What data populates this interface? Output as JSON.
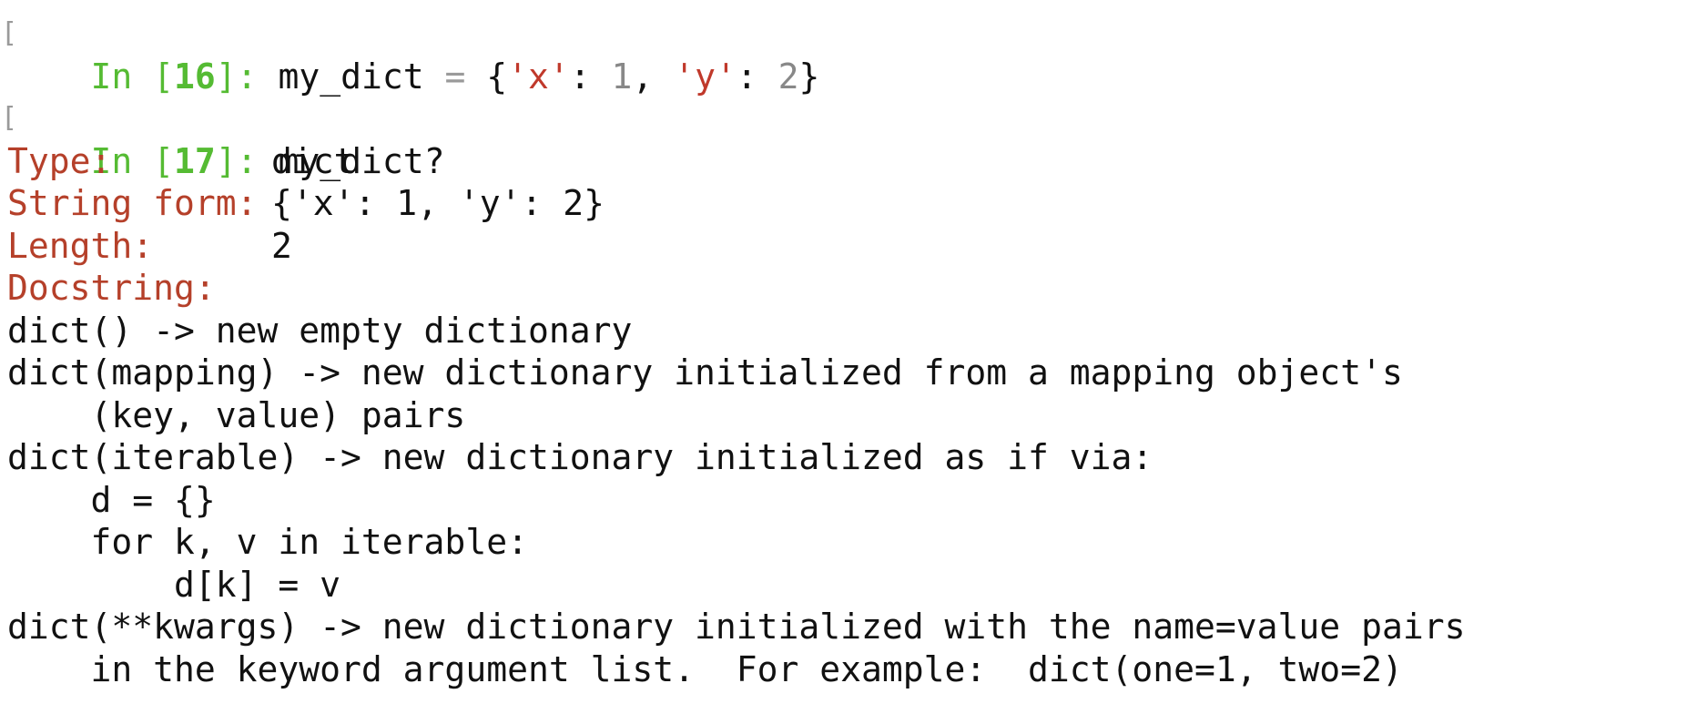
{
  "colors": {
    "prompt_green": "#55bb33",
    "string_red": "#c0392b",
    "number_gray": "#888888",
    "header_red": "#b5402a",
    "text": "#111111",
    "background": "#ffffff"
  },
  "cell16": {
    "prompt_in": "In ",
    "prompt_lbr": "[",
    "prompt_num": "16",
    "prompt_rbr": "]: ",
    "code_a": "my_dict ",
    "code_eq": "=",
    "code_b": " {",
    "str_x": "'x'",
    "colon1": ": ",
    "num1": "1",
    "comma": ", ",
    "str_y": "'y'",
    "colon2": ": ",
    "num2": "2",
    "close": "}"
  },
  "cell17": {
    "prompt_in": "In ",
    "prompt_lbr": "[",
    "prompt_num": "17",
    "prompt_rbr": "]: ",
    "code": "my_dict?"
  },
  "info": {
    "type_label": "Type:",
    "type_value": "dict",
    "string_form_label": "String form:",
    "string_form_value": "{'x': 1, 'y': 2}",
    "length_label": "Length:",
    "length_value": "2",
    "docstring_label": "Docstring:"
  },
  "docstring_lines": [
    "dict() -> new empty dictionary",
    "dict(mapping) -> new dictionary initialized from a mapping object's",
    "    (key, value) pairs",
    "dict(iterable) -> new dictionary initialized as if via:",
    "    d = {}",
    "    for k, v in iterable:",
    "        d[k] = v",
    "dict(**kwargs) -> new dictionary initialized with the name=value pairs",
    "    in the keyword argument list.  For example:  dict(one=1, two=2)"
  ]
}
